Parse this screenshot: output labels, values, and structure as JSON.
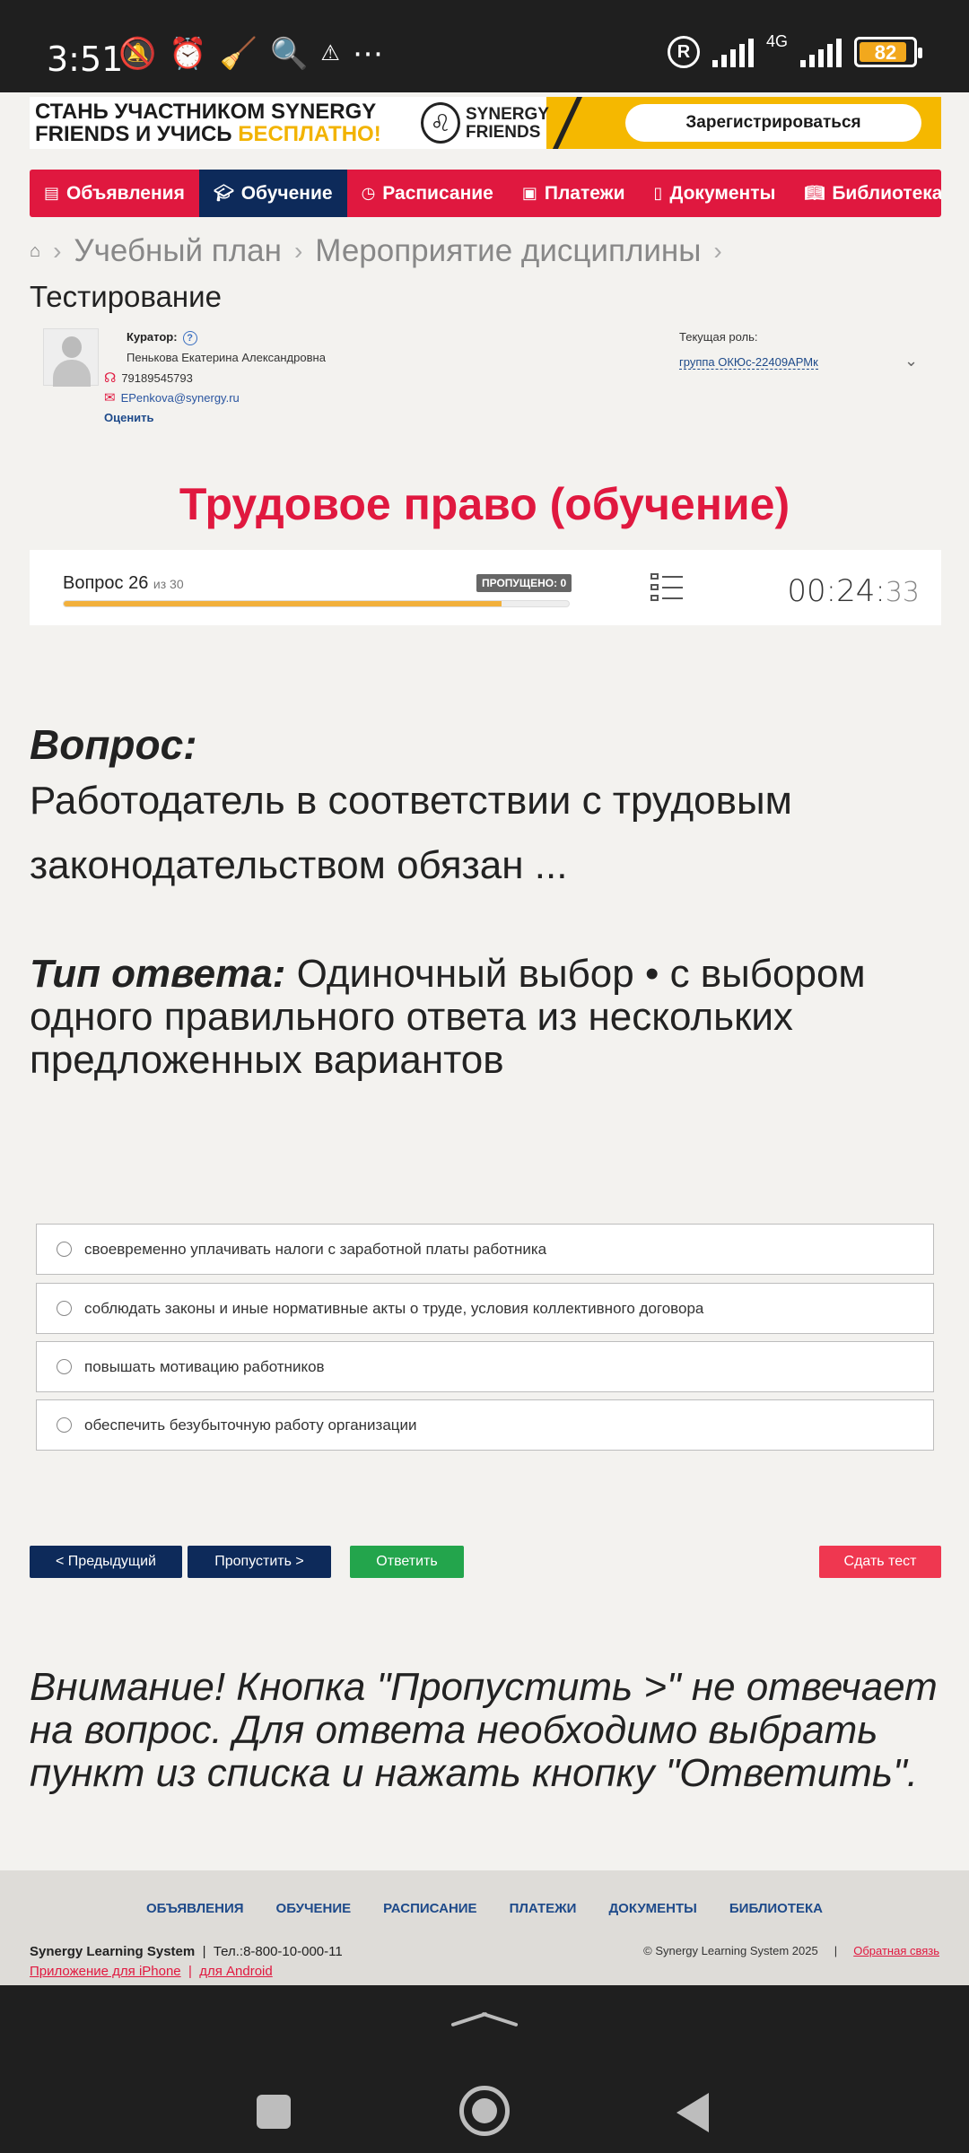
{
  "status": {
    "time": "3:51",
    "network": "4G",
    "battery": "82"
  },
  "banner": {
    "line1": "СТАНЬ УЧАСТНИКОМ SYNERGY",
    "line2a": "FRIENDS И УЧИСЬ ",
    "line2b": "БЕСПЛАТНО!",
    "logo_line1": "SYNERGY",
    "logo_line2": "FRIENDS",
    "register": "Зарегистрироваться"
  },
  "nav": {
    "items": [
      {
        "label": "Объявления",
        "icon": "list-icon"
      },
      {
        "label": "Обучение",
        "icon": "graduation-cap-icon",
        "active": true
      },
      {
        "label": "Расписание",
        "icon": "clock-icon"
      },
      {
        "label": "Платежи",
        "icon": "money-icon"
      },
      {
        "label": "Документы",
        "icon": "document-icon"
      },
      {
        "label": "Библиотека",
        "icon": "book-icon"
      }
    ]
  },
  "breadcrumb": [
    "Учебный план",
    "Мероприятие дисциплины"
  ],
  "page_title": "Тестирование",
  "curator": {
    "label": "Куратор:",
    "name": "Пенькова Екатерина Александровна",
    "phone": "79189545793",
    "email": "EPenkova@synergy.ru",
    "rate": "Оценить"
  },
  "role": {
    "label": "Текущая роль:",
    "value": "группа ОКЮс-22409АРМк"
  },
  "course_title": "Трудовое право (обучение)",
  "progress": {
    "question_label": "Вопрос 26",
    "of_label": "из 30",
    "skipped": "ПРОПУЩЕНО: 0",
    "fraction": 0.867,
    "timer_main": "00:24:",
    "timer_sec": "33"
  },
  "question": {
    "heading": "Вопрос:",
    "text": "Работодатель в соответствии с трудовым законодательством обязан ...",
    "type_label": "Тип ответа:",
    "type_value": " Одиночный выбор • с выбором одного правильного ответа из нескольких предложенных вариантов"
  },
  "options": [
    "своевременно уплачивать налоги с заработной платы работника",
    "соблюдать законы и иные нормативные акты о труде, условия коллективного договора",
    "повышать мотивацию работников",
    "обеспечить безубыточную работу организации"
  ],
  "buttons": {
    "prev": "< Предыдущий",
    "skip": "Пропустить >",
    "answer": "Ответить",
    "finish": "Сдать тест"
  },
  "notice": "Внимание! Кнопка \"Пропустить >\" не отвечает на вопрос. Для ответа необходимо выбрать пункт из списка и нажать кнопку \"Ответить\".",
  "footer": {
    "links": [
      "ОБЪЯВЛЕНИЯ",
      "ОБУЧЕНИЕ",
      "РАСПИСАНИЕ",
      "ПЛАТЕЖИ",
      "ДОКУМЕНТЫ",
      "БИБЛИОТЕКА"
    ],
    "company": "Synergy Learning System",
    "phone": "Тел.:8-800-10-000-11",
    "iphone": "Приложение для iPhone",
    "android": "для Android",
    "copyright": "© Synergy Learning System 2025",
    "feedback": "Обратная связь"
  },
  "colors": {
    "brand_red": "#e0183f",
    "navy": "#0d2a5a",
    "green": "#23a54c",
    "progress": "#f2b03c"
  }
}
